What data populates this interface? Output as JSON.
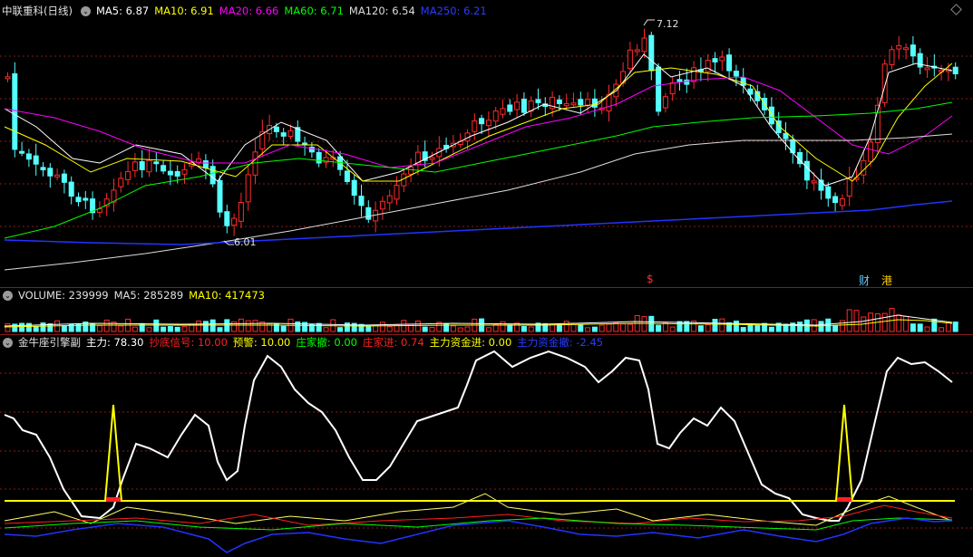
{
  "main_header": {
    "stock_name": "中联重科",
    "period": "(日线)",
    "ma": [
      {
        "label": "MA5: 6.87",
        "color": "#ffffff"
      },
      {
        "label": "MA10: 6.91",
        "color": "#ffff00"
      },
      {
        "label": "MA20: 6.66",
        "color": "#ff00ff"
      },
      {
        "label": "MA60: 6.71",
        "color": "#00ff00"
      },
      {
        "label": "MA120: 6.54",
        "color": "#dddddd"
      },
      {
        "label": "MA250: 6.21",
        "color": "#0000ff"
      }
    ]
  },
  "annotations": {
    "high_price": "7.12",
    "low_price": "6.01",
    "dollar_marker": "$",
    "finance_marker": "财",
    "hk_marker": "港"
  },
  "volume_header": {
    "volume": "VOLUME: 239999",
    "ma5": "MA5: 285289",
    "ma10": "MA10: 417473"
  },
  "indicator_header": {
    "name": "金牛座引擎副",
    "items": [
      {
        "label": "主力: 78.30",
        "color": "#ffffff"
      },
      {
        "label": "抄底信号: 10.00",
        "color": "#ff2020"
      },
      {
        "label": "预警: 10.00",
        "color": "#ffff00"
      },
      {
        "label": "庄家撤: 0.00",
        "color": "#00ff00"
      },
      {
        "label": "庄家进: 0.74",
        "color": "#ff2020"
      },
      {
        "label": "主力资金进: 0.00",
        "color": "#ffff00"
      },
      {
        "label": "主力资金撤: -2.45",
        "color": "#0000ff"
      }
    ]
  },
  "chart_data": {
    "type": "candlestick",
    "symbol": "中联重科",
    "period": "日线",
    "price_range": [
      6.01,
      7.12
    ],
    "high_marker": 7.12,
    "low_marker": 6.01,
    "latest_ma": {
      "MA5": 6.87,
      "MA10": 6.91,
      "MA20": 6.66,
      "MA60": 6.71,
      "MA120": 6.54,
      "MA250": 6.21
    },
    "volume": {
      "latest": 239999,
      "MA5": 285289,
      "MA10": 417473
    },
    "indicator": {
      "主力": 78.3,
      "抄底信号": 10.0,
      "预警": 10.0,
      "庄家撤": 0.0,
      "庄家进": 0.74,
      "主力资金进": 0.0,
      "主力资金撤": -2.45
    },
    "colors": {
      "up": "#ff2a2a",
      "down": "#54ffff",
      "grid": "#8b1a1a",
      "background": "#000000"
    }
  }
}
